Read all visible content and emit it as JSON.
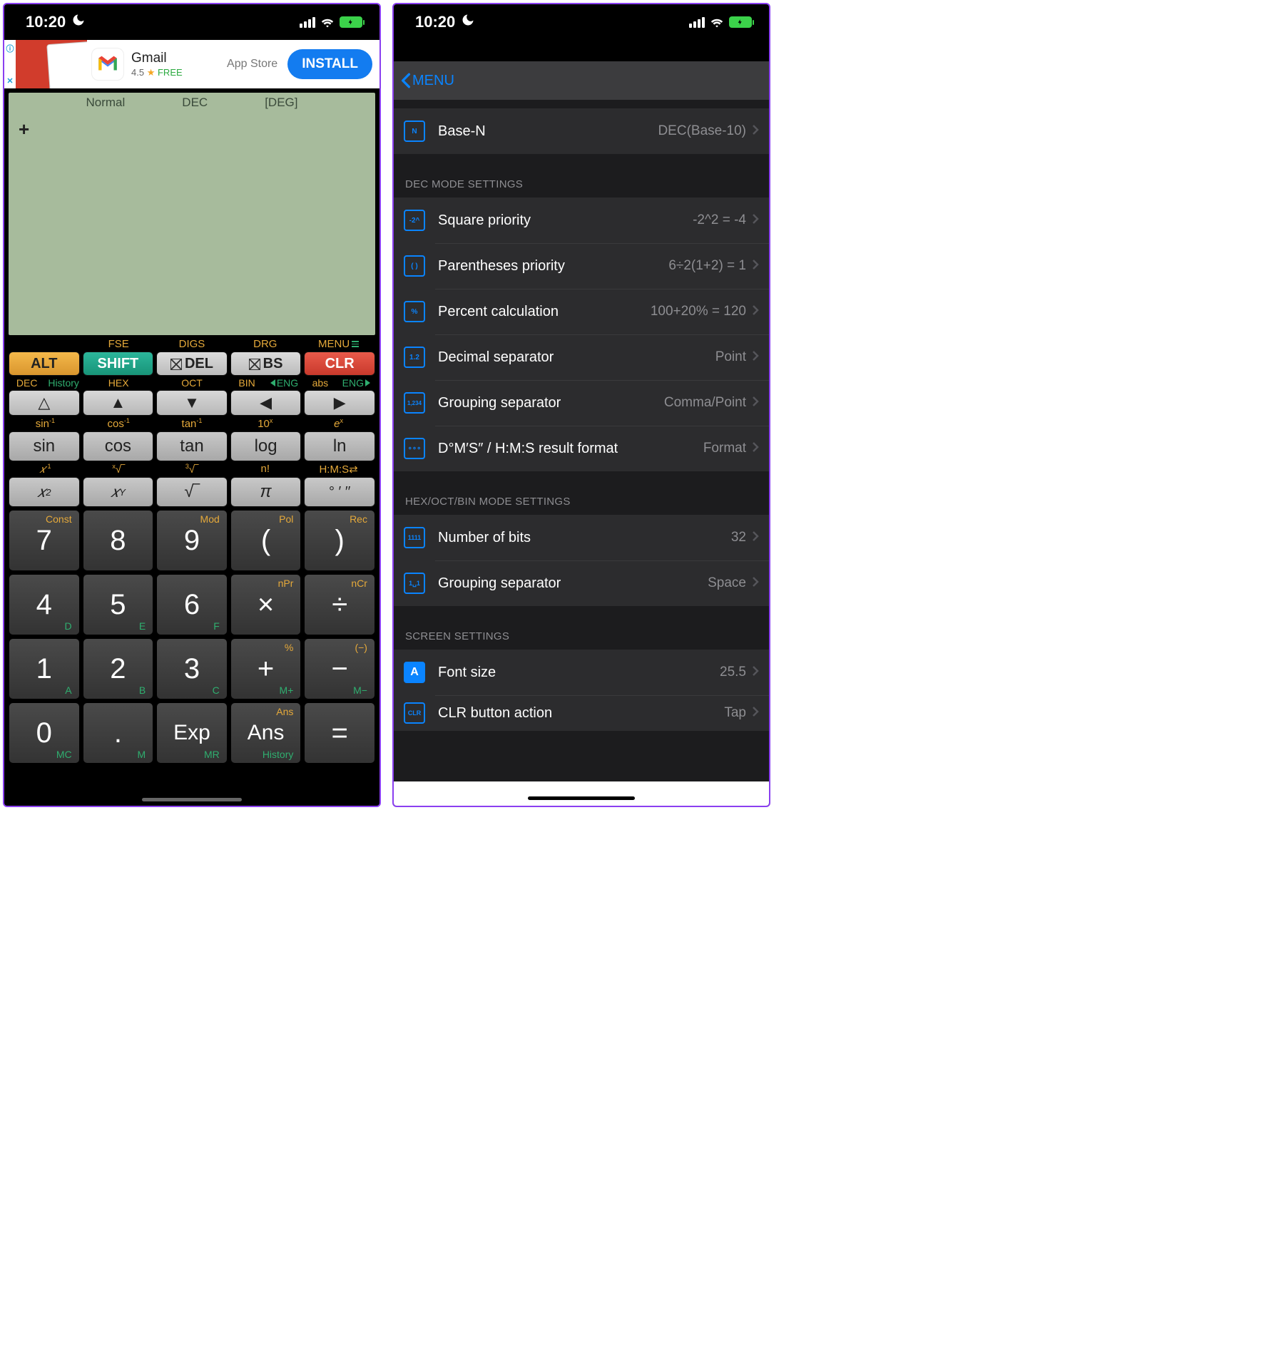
{
  "status": {
    "time": "10:20"
  },
  "ad": {
    "title": "Gmail",
    "rating": "4.5",
    "free": "FREE",
    "store": "App Store",
    "install": "INSTALL"
  },
  "screen": {
    "mode1": "Normal",
    "mode2": "DEC",
    "mode3": "[DEG]",
    "entry": "+"
  },
  "labels": {
    "fse": "FSE",
    "digs": "DIGS",
    "drg": "DRG",
    "menu": "MENU",
    "alt": "ALT",
    "shift": "SHIFT",
    "del": "DEL",
    "bs": "BS",
    "clr": "CLR",
    "dec": "DEC",
    "history": "History",
    "hex": "HEX",
    "oct": "OCT",
    "bin": "BIN",
    "eng_l": "ENG",
    "abs": "abs",
    "eng_r": "ENG",
    "asin": "sin⁻¹",
    "acos": "cos⁻¹",
    "atan": "tan⁻¹",
    "tenx": "10ˣ",
    "ex": "eˣ",
    "sin": "sin",
    "cos": "cos",
    "tan": "tan",
    "log": "log",
    "ln": "ln",
    "xinv": "𝑥⁻¹",
    "xroot": "ˣ√‾",
    "cuberoot": "³√‾",
    "fact": "n!",
    "hms": "H:M:S⇄",
    "xsq": "𝑥²",
    "xy": "𝑥ʸ",
    "sqrt": "√‾",
    "pi": "π",
    "dms": "°  ′  ′′",
    "const": "Const",
    "mod": "Mod",
    "pol": "Pol",
    "rec": "Rec",
    "d": "D",
    "e": "E",
    "f": "F",
    "npr": "nPr",
    "ncr": "nCr",
    "pct": "%",
    "neg": "(−)",
    "a": "A",
    "b": "B",
    "c": "C",
    "mplus": "M+",
    "mminus": "M−",
    "ans_y": "Ans",
    "mc": "MC",
    "m": "M",
    "mr": "MR",
    "hist2": "History",
    "k7": "7",
    "k8": "8",
    "k9": "9",
    "kpo": "(",
    "kpc": ")",
    "k4": "4",
    "k5": "5",
    "k6": "6",
    "kmul": "×",
    "kdiv": "÷",
    "k1": "1",
    "k2": "2",
    "k3": "3",
    "kplus": "+",
    "kmin": "−",
    "k0": "0",
    "kdot": ".",
    "kexp": "Exp",
    "kans": "Ans",
    "keq": "="
  },
  "menu": {
    "back": "MENU",
    "sections": {
      "base_n": {
        "label": "Base-N",
        "value": "DEC(Base-10)"
      },
      "dec_header": "DEC MODE SETTINGS",
      "sq_priority": {
        "label": "Square priority",
        "value": "-2^2 = -4"
      },
      "paren_priority": {
        "label": "Parentheses priority",
        "value": "6÷2(1+2) = 1"
      },
      "percent": {
        "label": "Percent calculation",
        "value": "100+20% = 120"
      },
      "dec_sep": {
        "label": "Decimal separator",
        "value": "Point"
      },
      "group_sep": {
        "label": "Grouping separator",
        "value": "Comma/Point"
      },
      "dms_format": {
        "label": "D°M′S″ / H:M:S result format",
        "value": "Format"
      },
      "hex_header": "HEX/OCT/BIN MODE SETTINGS",
      "num_bits": {
        "label": "Number of bits",
        "value": "32"
      },
      "hex_group": {
        "label": "Grouping separator",
        "value": "Space"
      },
      "screen_header": "SCREEN SETTINGS",
      "font_size": {
        "label": "Font size",
        "value": "25.5"
      },
      "clr_action": {
        "label": "CLR button action",
        "value": "Tap"
      }
    }
  }
}
